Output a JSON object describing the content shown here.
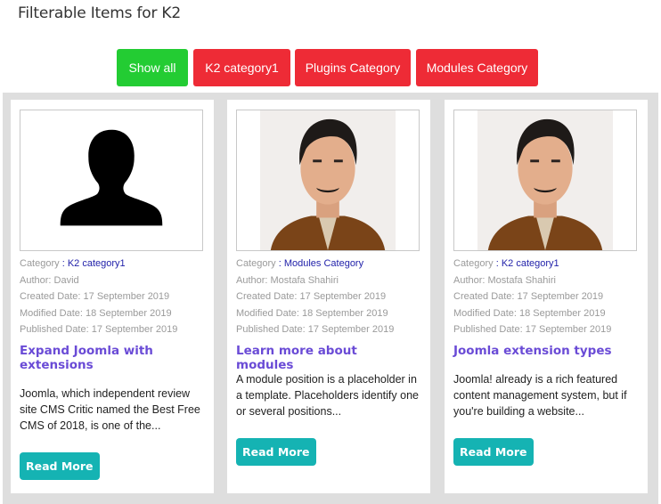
{
  "page": {
    "title": "Filterable Items for K2"
  },
  "filters": [
    {
      "label": "Show all",
      "color": "#23cc33",
      "active": true
    },
    {
      "label": "K2 category1",
      "color": "#ee2b36"
    },
    {
      "label": "Plugins Category",
      "color": "#ee2b36"
    },
    {
      "label": "Modules Category",
      "color": "#ee2b36"
    }
  ],
  "colors": {
    "title_link": "#6a4bd6",
    "read_more": "#15b3b3",
    "category_link": "#2222aa",
    "meta_text": "#9a9a9a"
  },
  "items": [
    {
      "image": "avatar-placeholder-silhouette",
      "category_label": "Category",
      "category_sep": ":",
      "category": "K2 category1",
      "author": "Author: David",
      "created": "Created Date: 17 September 2019",
      "modified": "Modified Date: 18 September 2019",
      "published": "Published Date: 17 September 2019",
      "title": "Expand Joomla with extensions",
      "excerpt": "Joomla, which independent review site CMS Critic named the Best Free CMS of 2018, is one of the...",
      "read_more": "Read More"
    },
    {
      "image": "author-portrait-photo",
      "category_label": "Category",
      "category_sep": ":",
      "category": "Modules Category",
      "author": "Author: Mostafa Shahiri",
      "created": "Created Date: 17 September 2019",
      "modified": "Modified Date: 18 September 2019",
      "published": "Published Date: 17 September 2019",
      "title": "Learn more about modules",
      "excerpt": "A module position is a placeholder in a template. Placeholders identify one or several positions...",
      "read_more": "Read More"
    },
    {
      "image": "author-portrait-photo",
      "category_label": "Category",
      "category_sep": ":",
      "category": "K2 category1",
      "author": "Author: Mostafa Shahiri",
      "created": "Created Date: 17 September 2019",
      "modified": "Modified Date: 18 September 2019",
      "published": "Published Date: 17 September 2019",
      "title": "Joomla extension types",
      "excerpt": "Joomla! already is a rich featured content management system, but if you're building a website...",
      "read_more": "Read More"
    }
  ]
}
